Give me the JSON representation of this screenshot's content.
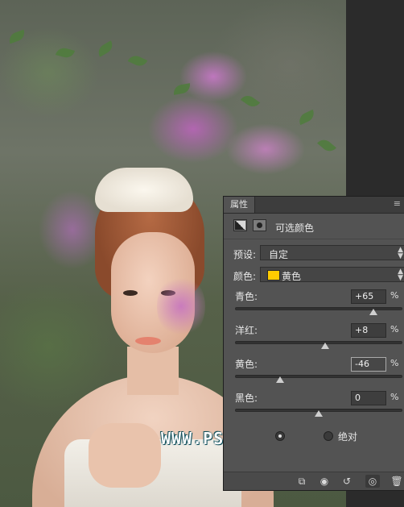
{
  "canvas": {
    "watermark": "WWW.PSAHZ.COM"
  },
  "panel": {
    "tab_label": "属性",
    "menu_icon": "panel-menu-icon",
    "header_title": "可选颜色",
    "preset": {
      "label": "预设:",
      "value": "自定"
    },
    "color": {
      "label": "颜色:",
      "value": "黄色",
      "swatch_color": "#ffcc00"
    },
    "sliders": [
      {
        "label": "青色:",
        "value": "+65",
        "unit": "%",
        "level": 0.825
      },
      {
        "label": "洋红:",
        "value": "+8",
        "unit": "%",
        "level": 0.54
      },
      {
        "label": "黄色:",
        "value": "-46",
        "unit": "%",
        "level": 0.27
      },
      {
        "label": "黑色:",
        "value": "0",
        "unit": "%",
        "level": 0.5
      }
    ],
    "method": {
      "relative_checked": true,
      "absolute_label": "绝对"
    },
    "bottom_icons": [
      "clip-to-layer-icon",
      "view-previous-state-icon",
      "reset-icon",
      "visibility-eye-icon",
      "trash-icon"
    ]
  }
}
